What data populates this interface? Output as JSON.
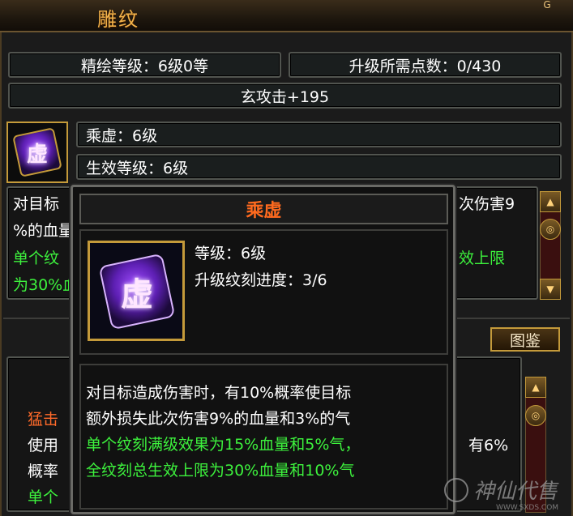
{
  "window": {
    "title": "雕纹",
    "close_icon": "G"
  },
  "stats": {
    "refine_level": "精绘等级：6级0等",
    "upgrade_points": "升级所需点数：0/430",
    "attack_bonus": "玄攻击+195"
  },
  "selected_rune": {
    "icon_char": "虚",
    "name_line": "乘虚：6级",
    "effect_level_line": "生效等级：6级"
  },
  "background_desc": {
    "line1_left": "对目标",
    "line1_right": "次伤害9",
    "line2_left": "%的血量",
    "line3_left": "单个纹",
    "line3_right": "效上限",
    "line4_left": "为30%血"
  },
  "lower_panel": {
    "tujian_label": "图鉴",
    "line1_left": "猛击",
    "line2_left": "使用",
    "line2_right": "有6%",
    "line3_left": "概率",
    "line4_left": "单个"
  },
  "tooltip": {
    "name": "乘虚",
    "icon_char": "虚",
    "level": "等级：6级",
    "carve_progress": "升级纹刻进度：3/6",
    "desc_white_1": "对目标造成伤害时，有10%概率使目标",
    "desc_white_2": "额外损失此次伤害9%的血量和3%的气",
    "desc_green_1": "单个纹刻满级效果为15%血量和5%气，",
    "desc_green_2": "全纹刻总生效上限为30%血量和10%气"
  },
  "watermark": {
    "text": "神仙代售",
    "url_text": "WWW.SXDS.COM"
  },
  "colors": {
    "title": "#f2b24a",
    "tooltip_name": "#ff6a1e",
    "green": "#3df23d",
    "orange": "#ff6a2a",
    "frame": "#51544f"
  }
}
